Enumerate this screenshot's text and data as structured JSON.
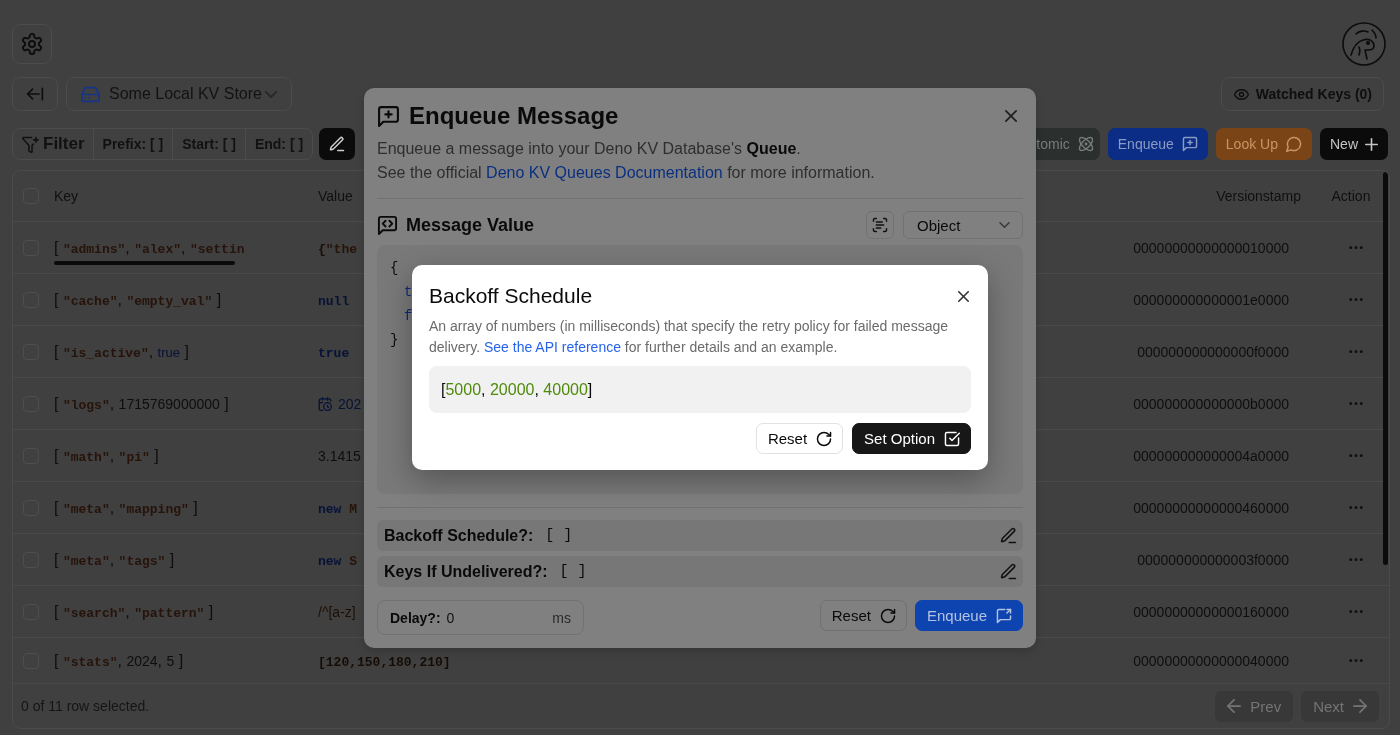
{
  "header": {
    "store": {
      "name": "Some Local KV Store"
    },
    "watched_keys": {
      "label": "Watched Keys (0)"
    }
  },
  "toolbar": {
    "filter": {
      "label": "Filter",
      "segments": [
        "Prefix: [ ]",
        "Start: [ ]",
        "End: [ ]"
      ]
    },
    "actions": [
      {
        "kind": "atomic",
        "label": "tomic"
      },
      {
        "kind": "enqueue",
        "label": "Enqueue"
      },
      {
        "kind": "lookup",
        "label": "Look Up"
      },
      {
        "kind": "new",
        "label": "New"
      }
    ]
  },
  "table": {
    "select_all": {
      "checked": false
    },
    "columns": [
      "Key",
      "Value",
      "Versionstamp",
      "Action"
    ],
    "rows": [
      {
        "checked": false,
        "scrollable": true,
        "key": [
          {
            "kind": "punct",
            "text": "[ "
          },
          {
            "kind": "string",
            "text": "\"admins\""
          },
          {
            "kind": "punct",
            "text": ", "
          },
          {
            "kind": "string",
            "text": "\"alex\""
          },
          {
            "kind": "punct",
            "text": ", "
          },
          {
            "kind": "string",
            "text": "\"settin"
          }
        ],
        "value": [
          {
            "kind": "code",
            "text": "{"
          },
          {
            "kind": "string",
            "text": "\"the"
          }
        ],
        "versionstamp": "00000000000000010000"
      },
      {
        "checked": false,
        "scrollable": false,
        "key": [
          {
            "kind": "punct",
            "text": "[ "
          },
          {
            "kind": "string",
            "text": "\"cache\""
          },
          {
            "kind": "punct",
            "text": ", "
          },
          {
            "kind": "string",
            "text": "\"empty_val\""
          },
          {
            "kind": "punct",
            "text": " ]"
          }
        ],
        "value": [
          {
            "kind": "keyword",
            "text": "null"
          }
        ],
        "versionstamp": "000000000000001e0000"
      },
      {
        "checked": false,
        "scrollable": false,
        "key": [
          {
            "kind": "punct",
            "text": "[ "
          },
          {
            "kind": "string",
            "text": "\"is_active\""
          },
          {
            "kind": "punct",
            "text": ", "
          },
          {
            "kind": "boolean",
            "text": "true"
          },
          {
            "kind": "punct",
            "text": " ]"
          }
        ],
        "value": [
          {
            "kind": "keyword",
            "text": "true"
          }
        ],
        "versionstamp": "000000000000000f0000"
      },
      {
        "checked": false,
        "scrollable": false,
        "key": [
          {
            "kind": "punct",
            "text": "[ "
          },
          {
            "kind": "string",
            "text": "\"logs\""
          },
          {
            "kind": "punct",
            "text": ", "
          },
          {
            "kind": "number",
            "text": "1715769000000"
          },
          {
            "kind": "punct",
            "text": " ]"
          }
        ],
        "value": [
          {
            "kind": "date",
            "text": "202"
          }
        ],
        "versionstamp": "000000000000000b0000"
      },
      {
        "checked": false,
        "scrollable": false,
        "key": [
          {
            "kind": "punct",
            "text": "[ "
          },
          {
            "kind": "string",
            "text": "\"math\""
          },
          {
            "kind": "punct",
            "text": ", "
          },
          {
            "kind": "string",
            "text": "\"pi\""
          },
          {
            "kind": "punct",
            "text": " ]"
          }
        ],
        "value": [
          {
            "kind": "number",
            "text": "3.1415"
          }
        ],
        "versionstamp": "000000000000004a0000"
      },
      {
        "checked": false,
        "scrollable": false,
        "key": [
          {
            "kind": "punct",
            "text": "[ "
          },
          {
            "kind": "string",
            "text": "\"meta\""
          },
          {
            "kind": "punct",
            "text": ", "
          },
          {
            "kind": "string",
            "text": "\"mapping\""
          },
          {
            "kind": "punct",
            "text": " ]"
          }
        ],
        "value": [
          {
            "kind": "keyword",
            "text": "new "
          },
          {
            "kind": "string",
            "text": "M"
          }
        ],
        "versionstamp": "00000000000000460000"
      },
      {
        "checked": false,
        "scrollable": false,
        "key": [
          {
            "kind": "punct",
            "text": "[ "
          },
          {
            "kind": "string",
            "text": "\"meta\""
          },
          {
            "kind": "punct",
            "text": ", "
          },
          {
            "kind": "string",
            "text": "\"tags\""
          },
          {
            "kind": "punct",
            "text": " ]"
          }
        ],
        "value": [
          {
            "kind": "keyword",
            "text": "new "
          },
          {
            "kind": "string",
            "text": "S"
          }
        ],
        "versionstamp": "000000000000003f0000"
      },
      {
        "checked": false,
        "scrollable": false,
        "key": [
          {
            "kind": "punct",
            "text": "[ "
          },
          {
            "kind": "string",
            "text": "\"search\""
          },
          {
            "kind": "punct",
            "text": ", "
          },
          {
            "kind": "string",
            "text": "\"pattern\""
          },
          {
            "kind": "punct",
            "text": " ]"
          }
        ],
        "value": [
          {
            "kind": "regex",
            "text": "/^[a-z]"
          }
        ],
        "versionstamp": "00000000000000160000"
      },
      {
        "checked": false,
        "scrollable": false,
        "key": [
          {
            "kind": "punct",
            "text": "[ "
          },
          {
            "kind": "string",
            "text": "\"stats\""
          },
          {
            "kind": "punct",
            "text": ", "
          },
          {
            "kind": "number",
            "text": "2024"
          },
          {
            "kind": "punct",
            "text": ", "
          },
          {
            "kind": "number",
            "text": "5"
          },
          {
            "kind": "punct",
            "text": " ]"
          }
        ],
        "value": [
          {
            "kind": "code",
            "text": "[120,150,180,210]"
          }
        ],
        "versionstamp": "00000000000000040000"
      }
    ],
    "footer": {
      "selection": "0 of 11 row selected.",
      "pagination": [
        {
          "kind": "prev",
          "label": "Prev",
          "disabled": true
        },
        {
          "kind": "next",
          "label": "Next",
          "disabled": true
        }
      ]
    }
  },
  "enqueue_dialog": {
    "title": "Enqueue Message",
    "description": "Enqueue a message into your Deno KV Database's **Queue**.",
    "docs_note": {
      "before": "See the official ",
      "link": "Deno KV Queues Documentation",
      "after": " for more information."
    },
    "message_value": {
      "title": "Message Value",
      "type": "Object",
      "code": {
        "open": "{",
        "entries": [
          {
            "key": "t"
          },
          {
            "key": "f"
          }
        ],
        "close": "}"
      }
    },
    "options": [
      {
        "label": "Backoff Schedule?:",
        "value": "[ ]"
      },
      {
        "label": "Keys If Undelivered?:",
        "value": "[ ]"
      }
    ],
    "delay": {
      "label": "Delay?:",
      "value": "0",
      "unit": "ms"
    },
    "buttons": [
      {
        "kind": "reset",
        "label": "Reset"
      },
      {
        "kind": "submit",
        "label": "Enqueue"
      }
    ]
  },
  "backoff_dialog": {
    "title": "Backoff Schedule",
    "description": {
      "before": "An array of numbers (in milliseconds) that specify the retry policy for failed message delivery. ",
      "link": "See the API reference",
      "after": " for further details and an example."
    },
    "value": [
      {
        "kind": "punct",
        "text": "["
      },
      {
        "kind": "number",
        "text": "5000"
      },
      {
        "kind": "punct",
        "text": ", "
      },
      {
        "kind": "number",
        "text": "20000"
      },
      {
        "kind": "punct",
        "text": ", "
      },
      {
        "kind": "number",
        "text": "40000"
      },
      {
        "kind": "punct",
        "text": "]"
      }
    ],
    "buttons": [
      {
        "kind": "reset",
        "label": "Reset"
      },
      {
        "kind": "confirm",
        "label": "Set Option"
      }
    ]
  }
}
